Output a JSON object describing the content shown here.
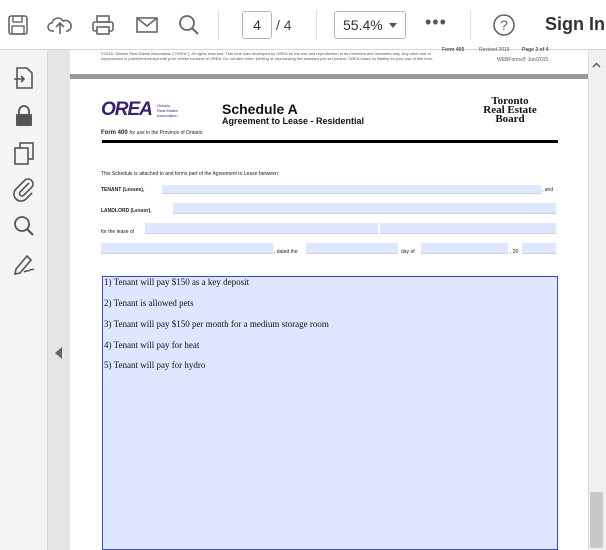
{
  "toolbar": {
    "page_current": "4",
    "page_sep_total": "/  4",
    "zoom": "55.4%",
    "more": "•••",
    "sign_in": "Sign In"
  },
  "document": {
    "header_line1": "©2015, Ontario Real Estate Association (\"OREA\"). All rights reserved. This form was developed by OREA for the use and reproduction of its members and licensees only. Any other use or",
    "header_line2": "reproduction is prohibited except with prior written consent of OREA. Do not alter when printing or reproducing the standard pre-set portion. OREA bears no liability for your use of this form.",
    "header_form": "Form 400",
    "header_revised": "Revised 2015",
    "header_page": "Page 3 of 4",
    "header_webforms": "WEBForms® Jun/2015",
    "orea_logo": "OREA",
    "orea_sub1": "Ontario",
    "orea_sub2": "Real Estate",
    "orea_sub3": "Association",
    "schedule_title": "Schedule A",
    "schedule_subtitle": "Agreement to Lease - Residential",
    "trb_line1": "Toronto",
    "trb_line2": "Real Estate",
    "trb_line3": "Board",
    "form_label": "Form 400",
    "form_usage": "for use in the Province of Ontario",
    "intro": "This Schedule is attached to and forms part of the Agreement to Lease between:",
    "tenant_label": "TENANT (Lessee),",
    "tenant_and": ", and",
    "landlord_label": "LANDLORD (Lessor),",
    "lease_of": "for the lease of",
    "dated_the": ", dated the",
    "day_of": "day of",
    "year": ", 20"
  },
  "schedule_text": {
    "line1": "1) Tenant will pay $150 as a key deposit",
    "line2": "2) Tenant is allowed pets",
    "line3": "3) Tenant will pay $150 per month for a medium storage room",
    "line4": "4) Tenant will pay for heat",
    "line5": "5) Tenant will pay for hydro"
  },
  "colors": {
    "orea_purple": "#3a1f6b",
    "field_fill": "#dfe6ff",
    "field_border": "#3b4cbd"
  }
}
